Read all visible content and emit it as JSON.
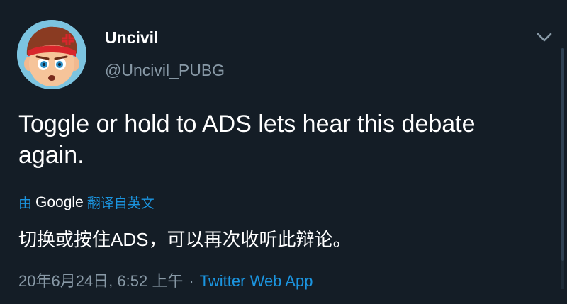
{
  "user": {
    "display_name": "Uncivil",
    "username": "@Uncivil_PUBG"
  },
  "tweet": {
    "text": "Toggle or hold to ADS lets hear this debate again."
  },
  "translation": {
    "prefix": "由",
    "provider": "Google",
    "suffix": "翻译自英文",
    "text": "切换或按住ADS，可以再次收听此辩论。"
  },
  "meta": {
    "timestamp": "20年6月24日, 6:52 上午",
    "separator": "·",
    "source": "Twitter Web App"
  },
  "icons": {
    "menu": "chevron-down-icon",
    "avatar": "cartoon-avatar"
  },
  "colors": {
    "background": "#141d26",
    "link": "#1b95e0",
    "secondary_text": "#8899a6"
  }
}
